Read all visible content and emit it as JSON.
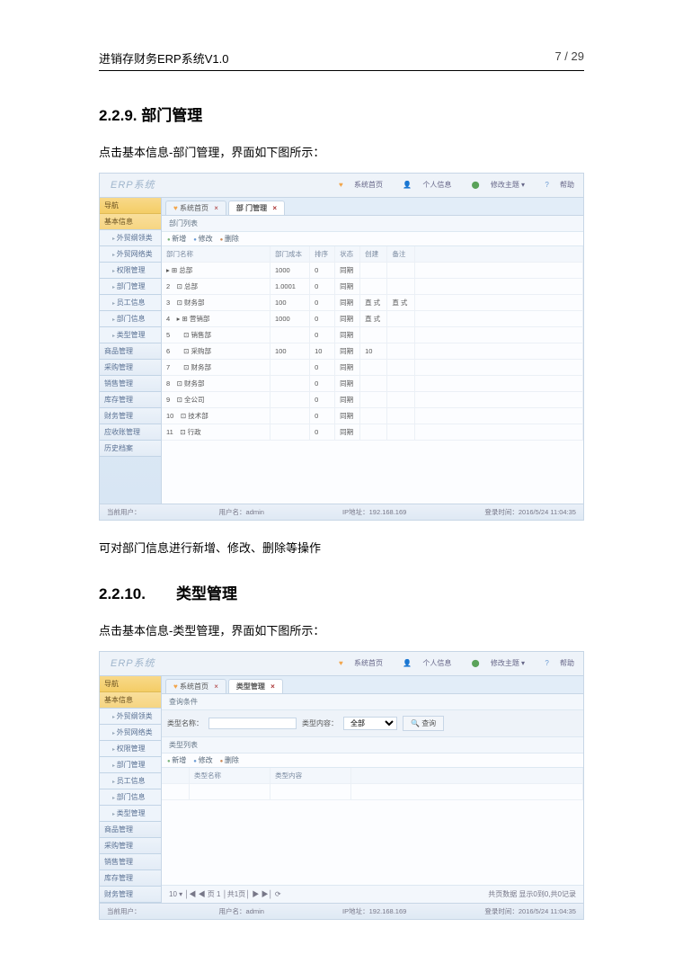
{
  "header": {
    "title": "进销存财务ERP系统V1.0",
    "page": "7 / 29"
  },
  "section1": {
    "num": "2.2.9. 部门管理",
    "intro": "点击基本信息-部门管理，界面如下图所示：",
    "outro": "可对部门信息进行新增、修改、删除等操作"
  },
  "section2": {
    "num": "2.2.10.　　类型管理",
    "intro": "点击基本信息-类型管理，界面如下图所示："
  },
  "app": {
    "logo": "ERP系统",
    "topbar": {
      "a": "系统首页",
      "b": "个人信息",
      "c": "修改主题 ▾",
      "d": "帮助"
    },
    "nav_title": "导航",
    "nav": {
      "basic": "基本信息",
      "items": [
        "外贸纲领类",
        "外贸网络类",
        "权限管理",
        "部门管理",
        "员工信息",
        "部门信息",
        "类型管理"
      ],
      "sections": [
        "商品管理",
        "采购管理",
        "销售管理",
        "库存管理",
        "财务管理",
        "应收账管理",
        "历史档案"
      ]
    },
    "tabs": {
      "home": "系统首页",
      "dept": "部 门管理",
      "type": "类型管理"
    },
    "shot1": {
      "panel": "部门列表",
      "btns": {
        "add": "新增",
        "edit": "修改",
        "del": "删除"
      },
      "cols": [
        "部门名称",
        "部门成本",
        "排序",
        "状态",
        "创建",
        "备注"
      ],
      "rows": [
        {
          "name": "▸ ⊞ 总部",
          "c2": "1000",
          "c3": "0",
          "c4": "同期",
          "c5": "",
          "c6": ""
        },
        {
          "name": "2　⊡ 总部",
          "c2": "1.0001",
          "c3": "0",
          "c4": "同期",
          "c5": "",
          "c6": ""
        },
        {
          "name": "3　⊡ 财务部",
          "c2": "100",
          "c3": "0",
          "c4": "同期",
          "c5": "直 式",
          "c6": "直 式"
        },
        {
          "name": "4　▸ ⊞ 营销部",
          "c2": "1000",
          "c3": "0",
          "c4": "同期",
          "c5": "直 式",
          "c6": ""
        },
        {
          "name": "5　　⊡ 销售部",
          "c2": "",
          "c3": "0",
          "c4": "同期",
          "c5": "",
          "c6": ""
        },
        {
          "name": "6　　⊡ 采购部",
          "c2": "100",
          "c3": "10",
          "c4": "同期",
          "c5": "10",
          "c6": ""
        },
        {
          "name": "7　　⊡ 财务部",
          "c2": "",
          "c3": "0",
          "c4": "同期",
          "c5": "",
          "c6": ""
        },
        {
          "name": "8　⊡ 财务部",
          "c2": "",
          "c3": "0",
          "c4": "同期",
          "c5": "",
          "c6": ""
        },
        {
          "name": "9　⊡ 全公司",
          "c2": "",
          "c3": "0",
          "c4": "同期",
          "c5": "",
          "c6": ""
        },
        {
          "name": "10　⊡ 技术部",
          "c2": "",
          "c3": "0",
          "c4": "同期",
          "c5": "",
          "c6": ""
        },
        {
          "name": "11　⊡ 行政",
          "c2": "",
          "c3": "0",
          "c4": "同期",
          "c5": "",
          "c6": ""
        }
      ]
    },
    "shot2": {
      "panel": "查询条件",
      "label1": "类型名称：",
      "label2": "类型内容：",
      "select": "全部",
      "btn": "查询",
      "listpanel": "类型列表",
      "cols": [
        "类型名称",
        "类型内容"
      ],
      "pager_left": "10 ▾ │◀ ◀ 页 1 │共1页│ ▶ ▶│ ⟳",
      "pager_right": "共页数据 显示0到0,共0记录"
    },
    "status": {
      "a": "当前用户：",
      "user": "用户名：admin",
      "ip": "IP地址：192.168.169",
      "time": "登录时间：2016/5/24 11:04:35"
    }
  }
}
